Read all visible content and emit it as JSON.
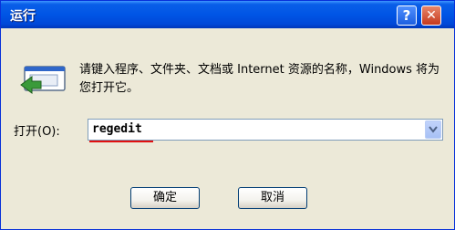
{
  "window": {
    "title": "运行",
    "help_label": "?",
    "close_label": "✕"
  },
  "description": "请键入程序、文件夹、文档或 Internet 资源的名称，Windows 将为您打开它。",
  "open": {
    "label": "打开(O):",
    "value": "regedit"
  },
  "buttons": {
    "ok": "确定",
    "cancel": "取消"
  },
  "colors": {
    "titlebar": "#0055e5",
    "background": "#ece9d8",
    "underline": "#e01010"
  }
}
